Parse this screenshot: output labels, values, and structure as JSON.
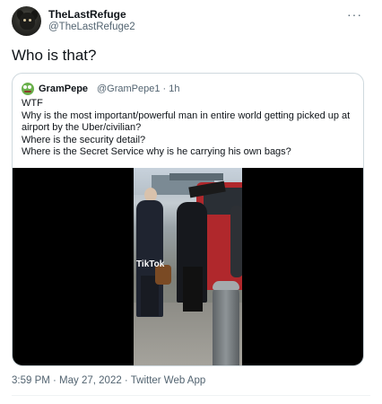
{
  "author": {
    "display_name": "TheLastRefuge",
    "handle": "@TheLastRefuge2"
  },
  "more_icon": "more-horizontal-icon",
  "tweet": {
    "text": "Who is that?"
  },
  "quote": {
    "display_name": "GramPepe",
    "meta": "@GramPepe1 · 1h",
    "lines": [
      "WTF",
      "Why is the most important/powerful man in entire world getting picked up at",
      "airport by the Uber/civilian?",
      "Where is the security detail?",
      "Where is the Secret Service why is he carrying his own bags?"
    ],
    "video": {
      "watermark": "TikTok"
    }
  },
  "footer": {
    "timestamp": "3:59 PM · May 27, 2022 · Twitter Web App"
  }
}
